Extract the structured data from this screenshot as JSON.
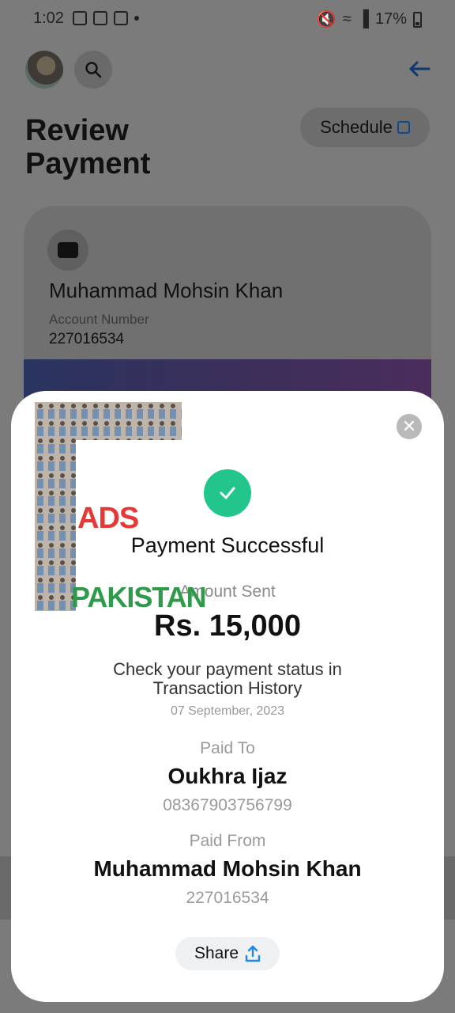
{
  "status_bar": {
    "time": "1:02",
    "battery": "17%"
  },
  "header": {
    "title_line1": "Review",
    "title_line2": "Payment",
    "schedule_label": "Schedule"
  },
  "account_card": {
    "name": "Muhammad Mohsin Khan",
    "account_label": "Account Number",
    "account_number": "227016534"
  },
  "modal": {
    "title": "Payment Successful",
    "amount_label": "Amount Sent",
    "amount_value": "Rs. 15,000",
    "status_message": "Check your payment status in Transaction History",
    "date": "07 September, 2023",
    "paid_to_label": "Paid To",
    "paid_to_name": "Oukhra Ijaz",
    "paid_to_number": "08367903756799",
    "paid_from_label": "Paid From",
    "paid_from_name": "Muhammad Mohsin Khan",
    "paid_from_number": "227016534",
    "share_label": "Share"
  },
  "watermark": {
    "word1": "ADS",
    "word2": "PAKISTAN"
  },
  "colors": {
    "success": "#22c58b",
    "share_icon": "#1e88e5",
    "back_arrow": "#0e3a6d"
  }
}
